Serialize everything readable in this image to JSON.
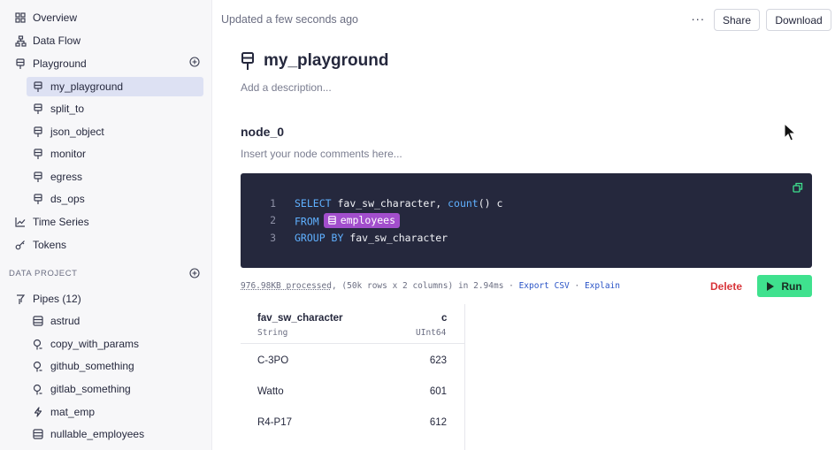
{
  "sidebar": {
    "top_items": [
      {
        "label": "Overview",
        "icon": "grid-icon"
      },
      {
        "label": "Data Flow",
        "icon": "flow-icon"
      },
      {
        "label": "Playground",
        "icon": "playground-icon"
      }
    ],
    "playground_items": [
      {
        "label": "my_playground",
        "active": true
      },
      {
        "label": "split_to"
      },
      {
        "label": "json_object"
      },
      {
        "label": "monitor"
      },
      {
        "label": "egress"
      },
      {
        "label": "ds_ops"
      }
    ],
    "bottom_items": [
      {
        "label": "Time Series",
        "icon": "chart-icon"
      },
      {
        "label": "Tokens",
        "icon": "key-icon"
      }
    ],
    "section_label": "DATA PROJECT",
    "pipes_label": "Pipes (12)",
    "pipes": [
      {
        "label": "astrud",
        "icon": "datasource-icon"
      },
      {
        "label": "copy_with_params",
        "icon": "pipe-icon"
      },
      {
        "label": "github_something",
        "icon": "pipe-icon"
      },
      {
        "label": "gitlab_something",
        "icon": "pipe-icon"
      },
      {
        "label": "mat_emp",
        "icon": "bolt-icon"
      },
      {
        "label": "nullable_employees",
        "icon": "datasource-icon"
      }
    ]
  },
  "header": {
    "updated": "Updated a few seconds ago",
    "more": "···",
    "share": "Share",
    "download": "Download"
  },
  "main": {
    "title": "my_playground",
    "description_placeholder": "Add a description...",
    "node": {
      "name": "node_0",
      "comment_placeholder": "Insert your node comments here...",
      "code": {
        "line_numbers": [
          "1",
          "2",
          "3"
        ],
        "line1_kw": "SELECT",
        "line1_mid": " fav_sw_character, ",
        "line1_fn": "count",
        "line1_end": "() c",
        "line2_kw": "FROM",
        "line2_table": "employees",
        "line3_kw": "GROUP BY",
        "line3_rest": " fav_sw_character"
      },
      "stats": {
        "processed": "976.98KB processed",
        "rows": ", (50k rows x 2 columns) in 2.94ms · ",
        "export": "Export CSV",
        "sep": " · ",
        "explain": "Explain"
      },
      "delete": "Delete",
      "run": "Run"
    },
    "results": {
      "columns": [
        {
          "name": "fav_sw_character",
          "type": "String"
        },
        {
          "name": "c",
          "type": "UInt64"
        }
      ],
      "rows": [
        [
          "C-3PO",
          "623"
        ],
        [
          "Watto",
          "601"
        ],
        [
          "R4-P17",
          "612"
        ]
      ]
    }
  },
  "colors": {
    "accent_green": "#3fe18e",
    "delete_red": "#d8353a",
    "editor_bg": "#25283d",
    "table_chip": "#a24ecc",
    "link_blue": "#2a54c7"
  }
}
